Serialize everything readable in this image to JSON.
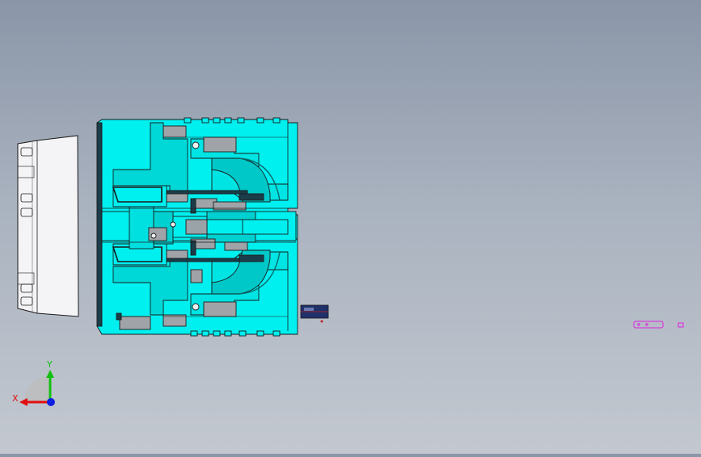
{
  "viewport": {
    "background_top": "#8a96a8",
    "background_bottom": "#c3c8d0"
  },
  "colors": {
    "mold_fill": "#00f0f0",
    "mold_shade": "#00c8c8",
    "outline": "#1a1a1a",
    "insert_gray": "#a0a4a8",
    "steel_dark": "#1a3d4a",
    "part_white": "#f4f4f6",
    "small_part_fill": "#20306a",
    "sketch_magenta": "#e020e0"
  },
  "triad": {
    "x_label": "X",
    "y_label": "Y",
    "x_color": "#e01010",
    "y_color": "#10c010",
    "z_color": "#1020e0"
  }
}
